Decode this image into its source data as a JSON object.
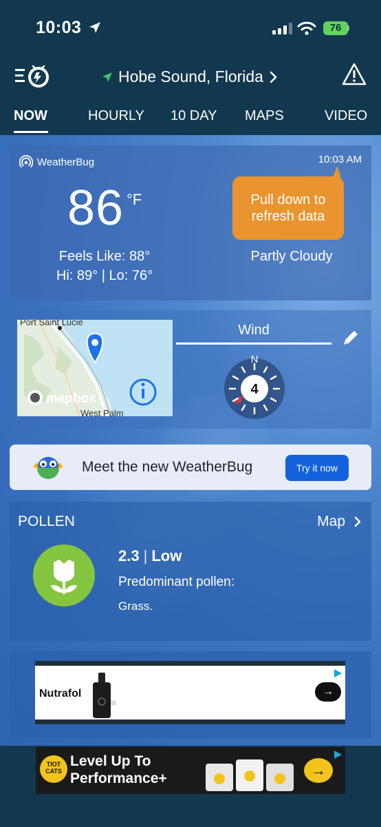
{
  "status_bar": {
    "time": "10:03",
    "battery": "76"
  },
  "header": {
    "location": "Hobe Sound, Florida"
  },
  "tabs": [
    {
      "label": "NOW"
    },
    {
      "label": "HOURLY"
    },
    {
      "label": "10 DAY"
    },
    {
      "label": "MAPS"
    },
    {
      "label": "VIDEO"
    }
  ],
  "current": {
    "brand": "WeatherBug",
    "time": "10:03 AM",
    "temperature": "86",
    "unit": "°F",
    "feels_like": "Feels Like: 88°",
    "hi_lo": "Hi: 89° | Lo: 76°",
    "tooltip": "Pull down to refresh data",
    "condition": "Partly Cloudy"
  },
  "map_card": {
    "place_top": "Port Saint Lucie",
    "place_bottom": "West Palm",
    "brand": "mapbox",
    "wind_title": "Wind",
    "compass_north": "N",
    "wind_speed": "4"
  },
  "promo": {
    "text": "Meet the new WeatherBug",
    "button": "Try it now"
  },
  "pollen": {
    "title": "POLLEN",
    "map_link": "Map",
    "value": "2.3",
    "level": "Low",
    "label": "Predominant pollen:",
    "type": "Grass."
  },
  "ads": {
    "ad1_brand": "Nutrafol",
    "ad2_badge": "TIOT CATS",
    "ad2_line1": "Level Up To",
    "ad2_line2": "Performance+"
  },
  "colors": {
    "accent_orange": "#e9942f",
    "pollen_green": "#84c63f",
    "button_blue": "#1361dd"
  }
}
